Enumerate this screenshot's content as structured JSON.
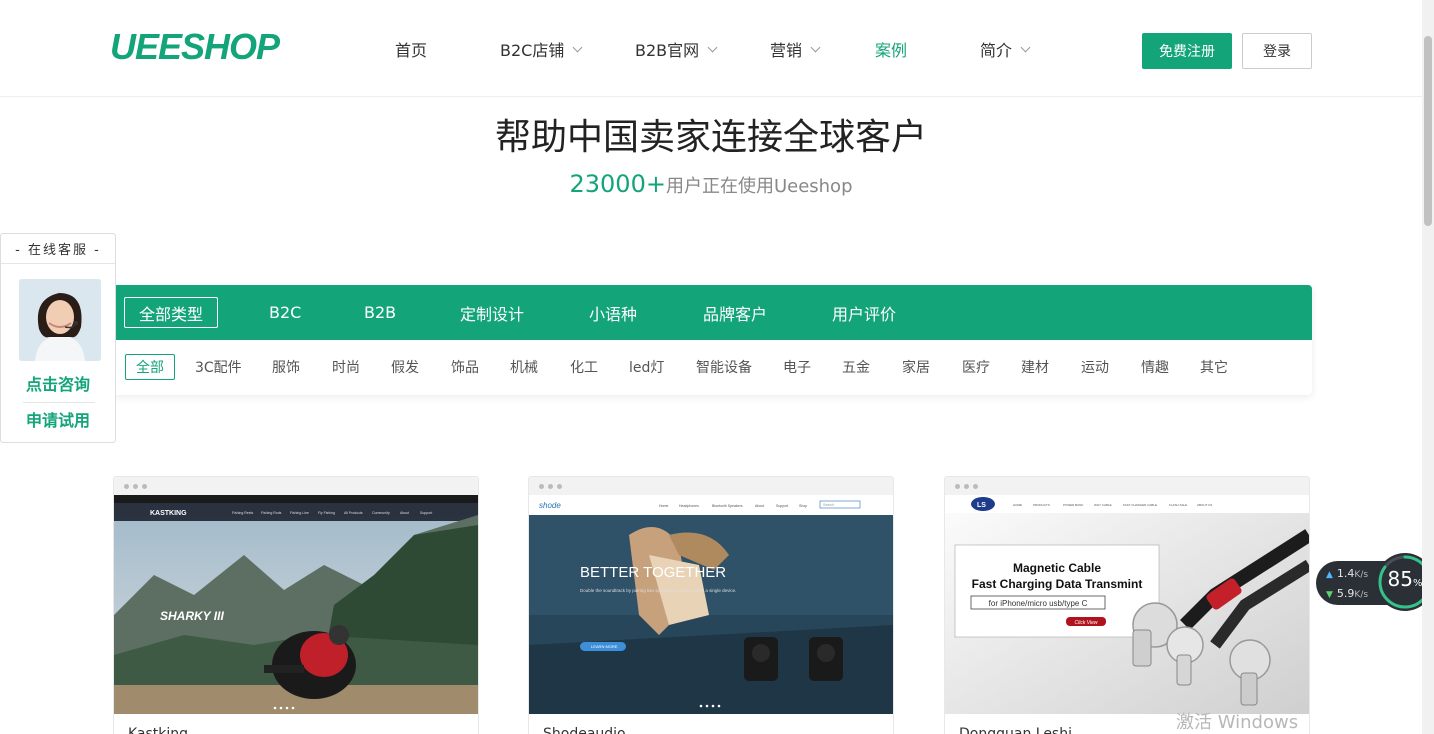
{
  "header": {
    "logo": "UEESHOP",
    "nav": [
      {
        "label": "首页",
        "dropdown": false
      },
      {
        "label": "B2C店铺",
        "dropdown": true
      },
      {
        "label": "B2B官网",
        "dropdown": true
      },
      {
        "label": "营销",
        "dropdown": true
      },
      {
        "label": "案例",
        "dropdown": false,
        "active": true
      },
      {
        "label": "简介",
        "dropdown": true
      }
    ],
    "register_label": "免费注册",
    "login_label": "登录"
  },
  "hero": {
    "title": "帮助中国卖家连接全球客户",
    "count": "23000+",
    "count_suffix": "用户正在使用Ueeshop"
  },
  "filter": {
    "types": [
      "全部类型",
      "B2C",
      "B2B",
      "定制设计",
      "小语种",
      "品牌客户",
      "用户评价"
    ],
    "active_type": "全部类型",
    "categories": [
      "全部",
      "3C配件",
      "服饰",
      "时尚",
      "假发",
      "饰品",
      "机械",
      "化工",
      "led灯",
      "智能设备",
      "电子",
      "五金",
      "家居",
      "医疗",
      "建材",
      "运动",
      "情趣",
      "其它"
    ],
    "active_category": "全部"
  },
  "service": {
    "title": "- 在线客服 -",
    "consult_label": "点击咨询",
    "trial_label": "申请试用"
  },
  "cases": [
    {
      "name": "Kastking",
      "shot_logo": "KASTKING",
      "shot_nav": [
        "Fishing Reels",
        "Fishing Rods",
        "Fishing Line",
        "Fly Fishing",
        "All Products",
        "Community",
        "About",
        "Support"
      ],
      "shot_headline": "SHARKY III"
    },
    {
      "name": "Shodeaudio",
      "shot_logo": "shode",
      "shot_nav": [
        "Home",
        "Headphones",
        "Bluetooth Speakers",
        "About",
        "Support",
        "Shop"
      ],
      "shot_search": "Search",
      "shot_headline": "BETTER TOGETHER",
      "shot_text": "Double the soundtrack by pairing two speakers in stereo using a single device.",
      "shot_button": "LEARN MORE"
    },
    {
      "name": "Dongguan Leshi",
      "shot_logo": "LS",
      "shot_nav": [
        "HOME",
        "PRODUCTS",
        "POWER BANK",
        "WHY CABLE",
        "FAST CHARGER CABLE",
        "FLASH SALE",
        "ABOUT US"
      ],
      "shot_headline_1": "Magnetic Cable",
      "shot_headline_2": "Fast Charging Data Transmint",
      "shot_sub": "for iPhone/micro usb/type C",
      "shot_button": "Click View"
    }
  ],
  "monitor": {
    "upload": "1.4",
    "download": "5.9",
    "unit": "K/s",
    "gauge": "85",
    "gauge_unit": "%"
  },
  "watermark": "激活 Windows",
  "colors": {
    "brand": "#13a47a"
  }
}
